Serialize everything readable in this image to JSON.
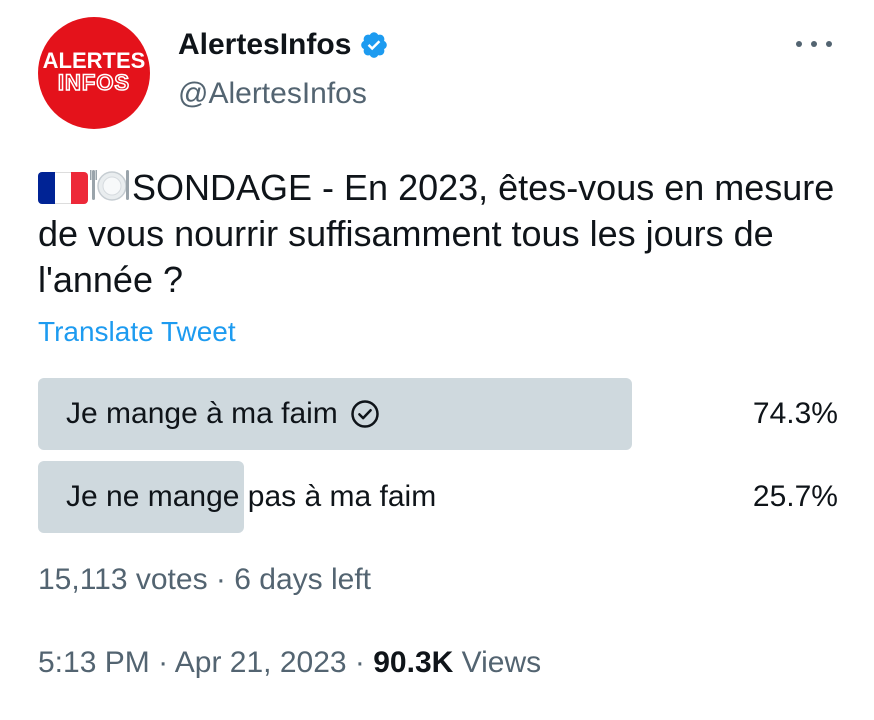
{
  "author": {
    "avatar_line1": "ALERTES",
    "avatar_line2": "INFOS",
    "display_name": "AlertesInfos",
    "handle": "@AlertesInfos",
    "verified": true,
    "verified_icon": "verified-badge-icon",
    "more_icon": "more-options-icon"
  },
  "tweet": {
    "emojis": [
      "flag-france-icon",
      "fork-and-knife-with-plate-icon"
    ],
    "text": "SONDAGE - En 2023, êtes-vous en mesure de vous nourrir suffisamment tous les jours de l'année ?",
    "translate_label": "Translate Tweet"
  },
  "poll": {
    "options": [
      {
        "label": "Je mange à ma faim",
        "percent": "74.3%",
        "fraction": 0.743,
        "winner": true
      },
      {
        "label": "Je ne mange pas à ma faim",
        "percent": "25.7%",
        "fraction": 0.257,
        "winner": false
      }
    ],
    "votes": "15,113 votes",
    "separator": "·",
    "time_left": "6 days left"
  },
  "meta": {
    "time": "5:13 PM",
    "separator1": "·",
    "date": "Apr 21, 2023",
    "separator2": "·",
    "views_count": "90.3K",
    "views_label": "Views"
  },
  "colors": {
    "avatar_red": "#e4121b",
    "verified_blue": "#1d9bf0",
    "link_blue": "#1d9bf0",
    "poll_bar": "#cfd9de",
    "secondary_text": "#536471",
    "primary_text": "#0f1419"
  }
}
